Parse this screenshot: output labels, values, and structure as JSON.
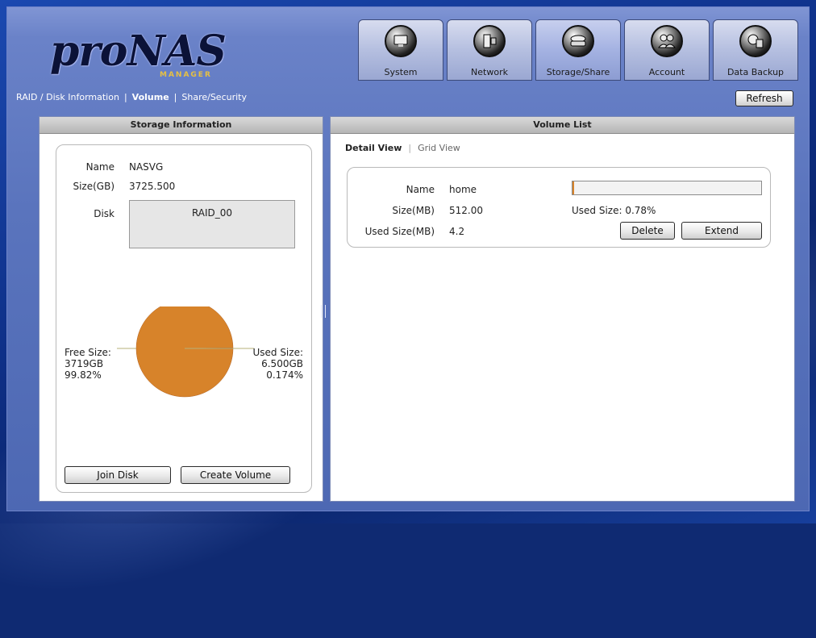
{
  "app": {
    "logo_text": "proNAS",
    "logo_sub": "MANAGER"
  },
  "topnav": [
    {
      "label": "System",
      "icon": "monitor-icon"
    },
    {
      "label": "Network",
      "icon": "network-icon"
    },
    {
      "label": "Storage/Share",
      "icon": "storage-icon",
      "active": true
    },
    {
      "label": "Account",
      "icon": "users-icon"
    },
    {
      "label": "Data Backup",
      "icon": "backup-icon"
    }
  ],
  "subnav": {
    "raid_label": "RAID / Disk Information",
    "volume_label": "Volume",
    "share_label": "Share/Security",
    "sep": "|"
  },
  "toolbar": {
    "refresh_label": "Refresh"
  },
  "storage": {
    "title": "Storage Information",
    "name_label": "Name",
    "name_value": "NASVG",
    "size_label": "Size(GB)",
    "size_value": "3725.500",
    "disk_label": "Disk",
    "disk_items": [
      "RAID_00"
    ],
    "chart": {
      "free_lines": [
        "Free Size:",
        "3719GB",
        "99.82%"
      ],
      "used_lines": [
        "Used Size:",
        "6.500GB",
        "0.174%"
      ]
    },
    "join_disk_label": "Join Disk",
    "create_volume_label": "Create Volume"
  },
  "chart_data": {
    "type": "pie",
    "title": "",
    "slices": [
      {
        "label": "Free Size",
        "value": 99.826,
        "color": "#d7832a"
      },
      {
        "label": "Used Size",
        "value": 0.174,
        "color": "#e0d48a"
      }
    ]
  },
  "volume_list": {
    "title": "Volume List",
    "tab_detail": "Detail View",
    "tab_grid": "Grid View",
    "tab_sep": "|",
    "volume": {
      "name_label": "Name",
      "name_value": "home",
      "size_label": "Size(MB)",
      "size_value": "512.00",
      "used_label": "Used Size(MB)",
      "used_value": "4.2",
      "used_pct_text": "Used Size: 0.78%",
      "used_fraction": 0.0078,
      "delete_label": "Delete",
      "extend_label": "Extend"
    }
  },
  "colors": {
    "accent_pie": "#d7832a",
    "frame": "#5a74bd"
  }
}
